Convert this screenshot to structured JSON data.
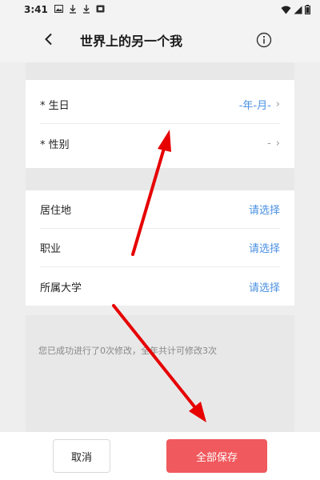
{
  "status_bar": {
    "time": "3:41",
    "icons": [
      "image-icon",
      "download-icon",
      "download-icon",
      "app-icon"
    ],
    "right_icons": [
      "wifi-icon",
      "signal-icon",
      "battery-icon"
    ]
  },
  "header": {
    "title": "世界上的另一个我",
    "back_icon": "chevron-left-icon",
    "info_icon": "info-circle-icon"
  },
  "profile_required": [
    {
      "label": "* 生日",
      "value": "-年-月-",
      "value_color": "#4a90e2"
    },
    {
      "label": "* 性别",
      "value": "-",
      "value_color": "#9a9a9a"
    }
  ],
  "profile_optional": [
    {
      "label": "居住地",
      "value": "请选择"
    },
    {
      "label": "职业",
      "value": "请选择"
    },
    {
      "label": "所属大学",
      "value": "请选择"
    }
  ],
  "note": "您已成功进行了0次修改，全年共计可修改3次",
  "footer": {
    "cancel_label": "取消",
    "save_label": "全部保存"
  },
  "colors": {
    "accent_blue": "#4a90e2",
    "save_red": "#f0595d",
    "annotation_red": "#e60000"
  }
}
